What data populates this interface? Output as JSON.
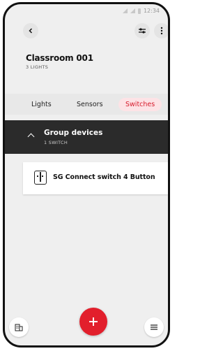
{
  "status": {
    "time": "12:34"
  },
  "header": {
    "title": "Classroom 001",
    "subtitle": "3 LIGHTS"
  },
  "tabs": [
    {
      "label": "Lights",
      "selected": false
    },
    {
      "label": "Sensors",
      "selected": false
    },
    {
      "label": "Switches",
      "selected": true
    }
  ],
  "group": {
    "title": "Group devices",
    "subtitle": "1 SWITCH",
    "expanded": true
  },
  "devices": [
    {
      "label": "SG Connect switch 4 Button",
      "icon": "wall-switch-icon"
    }
  ],
  "colors": {
    "accent": "#e21f2c",
    "tab_selected_bg": "#fde3e6",
    "group_bg": "#2b2b2b"
  },
  "icons": {
    "back": "chevron-left-icon",
    "filter": "sliders-icon",
    "more": "more-vertical-icon",
    "add": "plus-icon",
    "building": "building-icon",
    "menu": "menu-icon"
  }
}
